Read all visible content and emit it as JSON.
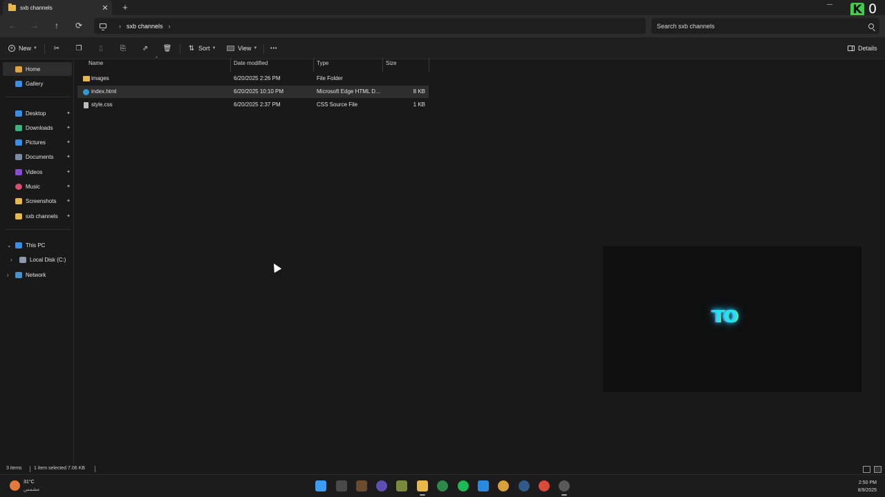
{
  "window": {
    "tab_title": "sxb channels",
    "close_glyph": "✕",
    "new_tab_glyph": "+",
    "overlay_badge_letter": "K",
    "overlay_count": "0"
  },
  "nav": {
    "back_glyph": "←",
    "forward_glyph": "→",
    "up_glyph": "↑",
    "refresh_glyph": "⟳",
    "breadcrumb": [
      "sxb channels"
    ],
    "chevron": "›",
    "search_placeholder": "Search sxb channels"
  },
  "commands": {
    "new_label": "New",
    "sort_label": "Sort",
    "view_label": "View",
    "more_glyph": "•••",
    "details_label": "Details",
    "icons": [
      "cut-icon",
      "copy-icon",
      "paste-icon",
      "rename-icon",
      "share-icon",
      "delete-icon"
    ]
  },
  "sidebar": {
    "items": [
      {
        "label": "Home",
        "icon": "home-icon",
        "color": "#e1a341",
        "pinned": false
      },
      {
        "label": "Gallery",
        "icon": "gallery-icon",
        "color": "#3a8ee6",
        "pinned": false
      },
      {
        "label": "Desktop",
        "icon": "desktop-icon",
        "color": "#3a8ee6",
        "pinned": true
      },
      {
        "label": "Downloads",
        "icon": "downloads-icon",
        "color": "#3ab47a",
        "pinned": true
      },
      {
        "label": "Pictures",
        "icon": "pictures-icon",
        "color": "#3a8ee6",
        "pinned": true
      },
      {
        "label": "Documents",
        "icon": "documents-icon",
        "color": "#7a8aa0",
        "pinned": true
      },
      {
        "label": "Videos",
        "icon": "videos-icon",
        "color": "#8a4ad6",
        "pinned": true
      },
      {
        "label": "Music",
        "icon": "music-icon",
        "color": "#d6506a",
        "pinned": true
      },
      {
        "label": "Screenshots",
        "icon": "folder-icon",
        "color": "#e8b84a",
        "pinned": true
      },
      {
        "label": "sxb channels",
        "icon": "folder-icon",
        "color": "#e8b84a",
        "pinned": true
      }
    ],
    "this_pc": "This PC",
    "local_disk": "Local Disk (C:)",
    "network": "Network",
    "pin_glyph": "✦",
    "expand_glyph": "›",
    "expanded_glyph": "⌄"
  },
  "columns": {
    "name": "Name",
    "date": "Date modified",
    "type": "Type",
    "size": "Size",
    "sort_caret": "^"
  },
  "files": [
    {
      "name": "images",
      "date": "6/20/2025 2:26 PM",
      "type": "File Folder",
      "size": "",
      "icon": "folder-icon",
      "color": "#e8b84a"
    },
    {
      "name": "index.html",
      "date": "6/20/2025 10:10 PM",
      "type": "Microsoft Edge HTML D...",
      "size": "8 KB",
      "icon": "edge-icon",
      "color": "#2f9bd6"
    },
    {
      "name": "style.css",
      "date": "6/20/2025 2:37 PM",
      "type": "CSS Source File",
      "size": "1 KB",
      "icon": "file-icon",
      "color": "#bdbdbd"
    }
  ],
  "preview": {
    "logo_text": "TO"
  },
  "status": {
    "items_count": "3 items",
    "selection": "1 item selected  7.06 KB"
  },
  "taskbar": {
    "weather_temp": "31°C",
    "weather_desc": "مشمس",
    "time": "2:50 PM",
    "date": "8/9/2025",
    "apps": [
      {
        "name": "start-icon",
        "color": "#3a9ef0"
      },
      {
        "name": "terminal-icon",
        "color": "#4a4a4a"
      },
      {
        "name": "minecraft-icon",
        "color": "#6a4b2e"
      },
      {
        "name": "unity-icon",
        "color": "#5e4fb5"
      },
      {
        "name": "launcher-icon",
        "color": "#7a8a3a"
      },
      {
        "name": "file-explorer-icon",
        "color": "#e8b84a"
      },
      {
        "name": "m-app-icon",
        "color": "#2d8a4a"
      },
      {
        "name": "spotify-icon",
        "color": "#1db954"
      },
      {
        "name": "vscode-icon",
        "color": "#2a8ae0"
      },
      {
        "name": "chrome-canary-icon",
        "color": "#d9a03a"
      },
      {
        "name": "steam-icon",
        "color": "#2f5a8a"
      },
      {
        "name": "chrome-icon",
        "color": "#d94a3a"
      },
      {
        "name": "obs-icon",
        "color": "#5a5a5a"
      }
    ]
  },
  "colors": {
    "accent": "#3a9ef0",
    "neon": "#1fe3ef"
  }
}
